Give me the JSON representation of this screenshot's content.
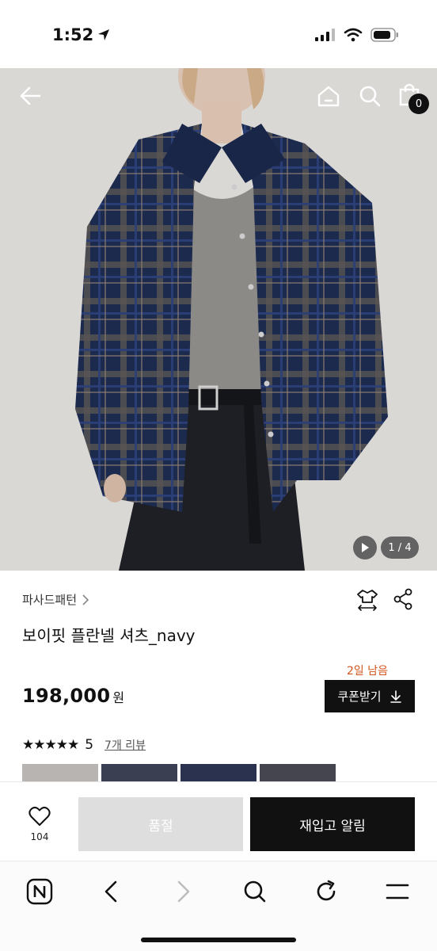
{
  "status_bar": {
    "time": "1:52"
  },
  "cart": {
    "count": "0"
  },
  "gallery": {
    "pager": "1 / 4"
  },
  "product": {
    "brand": "파사드패턴",
    "name": "보이핏 플란넬 셔츠_navy",
    "stock_notice": "2일 남음",
    "price": "198,000",
    "currency": "원",
    "coupon_label": "쿠폰받기",
    "rating": {
      "stars": "★★★★★",
      "score": "5",
      "reviews_label": "7개 리뷰"
    }
  },
  "actions": {
    "likes": "104",
    "soldout_label": "품절",
    "restock_label": "재입고 알림"
  },
  "colors": {
    "accent": "#d2541a",
    "primary": "#111111",
    "disabled": "#dedede"
  }
}
